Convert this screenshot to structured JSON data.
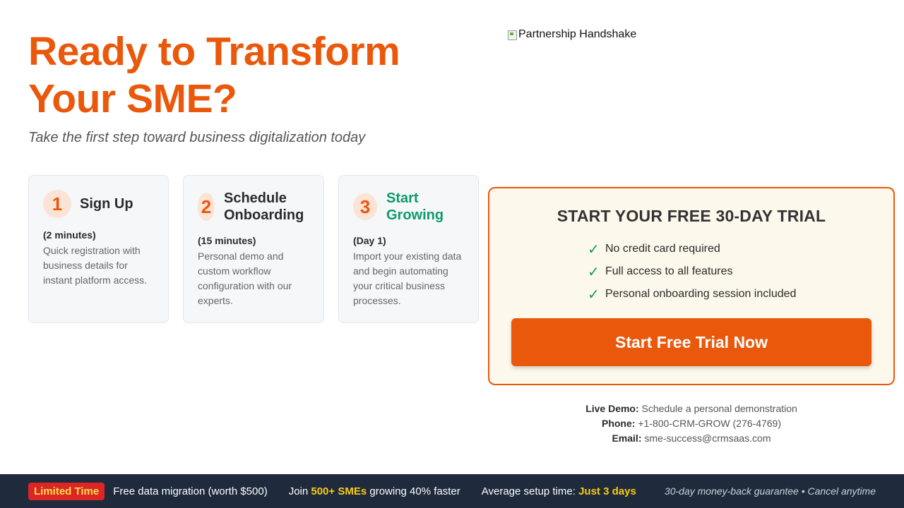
{
  "hero": {
    "headline": "Ready to Transform Your SME?",
    "subtitle": "Take the first step toward business digitalization today",
    "image_alt": "Partnership Handshake"
  },
  "steps": [
    {
      "number": "1",
      "title": "Sign Up",
      "time": "(2 minutes)",
      "description": "Quick registration with business details for instant platform access."
    },
    {
      "number": "2",
      "title": "Schedule Onboarding",
      "time": "(15 minutes)",
      "description": "Personal demo and custom workflow configuration with our experts."
    },
    {
      "number": "3",
      "title": "Start Growing",
      "time": "(Day 1)",
      "description": "Import your existing data and begin automating your critical business processes."
    }
  ],
  "trial": {
    "title": "START YOUR FREE 30-DAY TRIAL",
    "benefits": [
      "No credit card required",
      "Full access to all features",
      "Personal onboarding session included"
    ],
    "check_icon": "check-icon",
    "cta_label": "Start Free Trial Now"
  },
  "contact": {
    "live_demo_label": "Live Demo:",
    "live_demo_value": "Schedule a personal demonstration",
    "phone_label": "Phone:",
    "phone_value": "+1-800-CRM-GROW (276-4769)",
    "email_label": "Email:",
    "email_value": "sme-success@crmsaas.com"
  },
  "footer": {
    "badge": "Limited Time",
    "migration": "Free data migration (worth $500)",
    "join_prefix": "Join ",
    "join_highlight": "500+ SMEs",
    "join_suffix": " growing 40% faster",
    "setup_prefix": "Average setup time: ",
    "setup_highlight": "Just 3 days",
    "guarantee": "30-day money-back guarantee • Cancel anytime"
  },
  "colors": {
    "accent": "#ea580c",
    "green": "#0f9a6a",
    "footer_bg": "#1f2a3c",
    "badge_bg": "#dc2626",
    "highlight": "#facc15"
  }
}
